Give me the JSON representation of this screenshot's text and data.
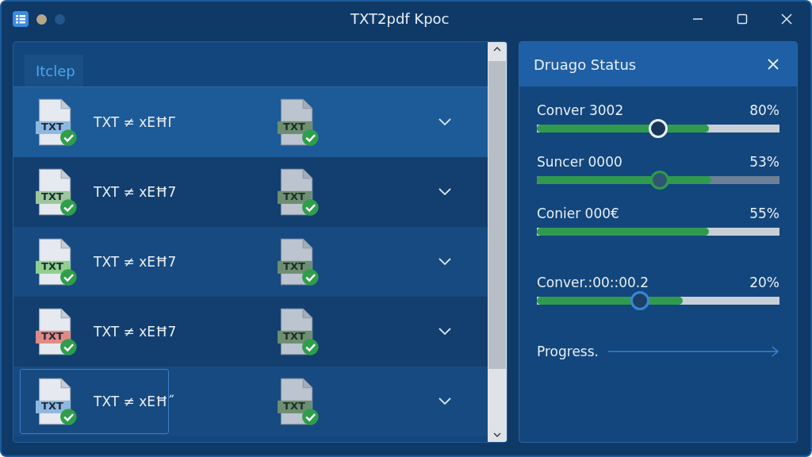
{
  "window": {
    "title": "TXT2pdf Kpoc"
  },
  "list": {
    "tab": "Itclep",
    "rows": [
      {
        "name": "TXT ≠ xEĦΓ",
        "badge": "TXT",
        "color": "#8fb8e0",
        "selected": true,
        "focused": false,
        "target_badge": "TXT"
      },
      {
        "name": "TXT ≠ xEĦ7",
        "badge": "TXT",
        "color": "#9cc79a",
        "selected": false,
        "focused": false,
        "target_badge": "TXT"
      },
      {
        "name": "TXT ≠ xEĦ7",
        "badge": "TXT",
        "color": "#8fd08f",
        "selected": false,
        "focused": false,
        "target_badge": "TXT"
      },
      {
        "name": "TXT ≠ xEĦ7",
        "badge": "TXT",
        "color": "#e08a86",
        "selected": false,
        "focused": false,
        "target_badge": "TXT"
      },
      {
        "name": "TXT ≠ xEĦ˝",
        "badge": "TXT",
        "color": "#8fb8e0",
        "selected": false,
        "focused": true,
        "target_badge": "TXT"
      }
    ]
  },
  "status": {
    "title": "Druago Status",
    "items": [
      {
        "kind": "slider",
        "label": "Conver 3002",
        "reading": "80%",
        "level": 0.71
      },
      {
        "kind": "slider",
        "label": "Suncer 0000",
        "reading": "53%",
        "level": 0.72
      },
      {
        "kind": "bar",
        "label": "Conier 000€",
        "reading": "55%",
        "level": 0.71
      },
      {
        "kind": "slider",
        "label": "Conver.:00::00.2",
        "reading": "20%",
        "level": 0.6
      }
    ],
    "footer": "Progress."
  }
}
